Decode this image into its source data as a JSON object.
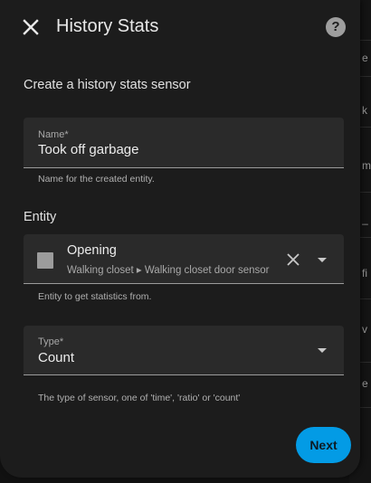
{
  "header": {
    "title": "History Stats",
    "help_glyph": "?"
  },
  "form": {
    "subtitle": "Create a history stats sensor",
    "name_field": {
      "label": "Name*",
      "value": "Took off garbage",
      "helper": "Name for the created entity."
    },
    "entity_section_label": "Entity",
    "entity_field": {
      "name": "Opening",
      "path": "Walking closet ▸ Walking closet door sensor",
      "helper": "Entity to get statistics from."
    },
    "type_field": {
      "label": "Type*",
      "value": "Count",
      "helper": "The type of sensor, one of 'time', 'ratio' or 'count'"
    }
  },
  "actions": {
    "next_label": "Next"
  },
  "background": {
    "edge_chars": [
      "e",
      "k",
      "m",
      "_",
      "fi",
      "v",
      "e"
    ]
  },
  "colors": {
    "accent": "#039be5",
    "dialog_bg": "#1c1c1c",
    "field_bg": "#2a2a2a"
  }
}
